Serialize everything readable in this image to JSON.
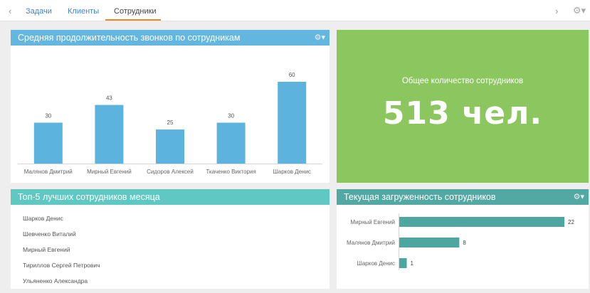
{
  "nav": {
    "back_icon": "‹",
    "forward_icon": "›",
    "tabs": [
      {
        "label": "Задачи"
      },
      {
        "label": "Клиенты"
      },
      {
        "label": "Сотрудники"
      }
    ],
    "active_tab": "Сотрудники",
    "settings_icon": "⚙▾"
  },
  "calls_panel": {
    "title": "Средняя продолжительность звонков по сотрудникам",
    "settings_icon": "⚙▾"
  },
  "total_panel": {
    "label": "Общее количество сотрудников",
    "value": "513 чел."
  },
  "top5_panel": {
    "title": "Топ-5 лучших сотрудников месяца",
    "items": [
      "Шарков Денис",
      "Шевченко Виталий",
      "Мирный Евгений",
      "Тириллов Сергей Петрович",
      "Ульяненко Александра"
    ]
  },
  "load_panel": {
    "title": "Текущая загруженность сотрудников",
    "settings_icon": "⚙▾"
  },
  "colors": {
    "calls_header": "#62b6df",
    "bar": "#5cb3de",
    "total_bg": "#8bc75e",
    "top5_header": "#5fc8c2",
    "load_header": "#52a8a3",
    "load_bar": "#4ea6a1"
  },
  "chart_data": [
    {
      "type": "bar",
      "title": "Средняя продолжительность звонков по сотрудникам",
      "categories": [
        "Малянов Дмитрий",
        "Мирный Евгений",
        "Сидоров Алексей",
        "Ткаченко Виктория",
        "Шарков Денис"
      ],
      "values": [
        30,
        43,
        25,
        30,
        60
      ],
      "ylim": [
        0,
        60
      ],
      "grid": false
    },
    {
      "type": "bar",
      "orientation": "horizontal",
      "title": "Текущая загруженность сотрудников",
      "categories": [
        "Мирный Евгений",
        "Малянов Дмитрий",
        "Шарков Денис"
      ],
      "values": [
        22,
        8,
        1
      ],
      "xlim": [
        0,
        22
      ],
      "grid": false
    }
  ]
}
